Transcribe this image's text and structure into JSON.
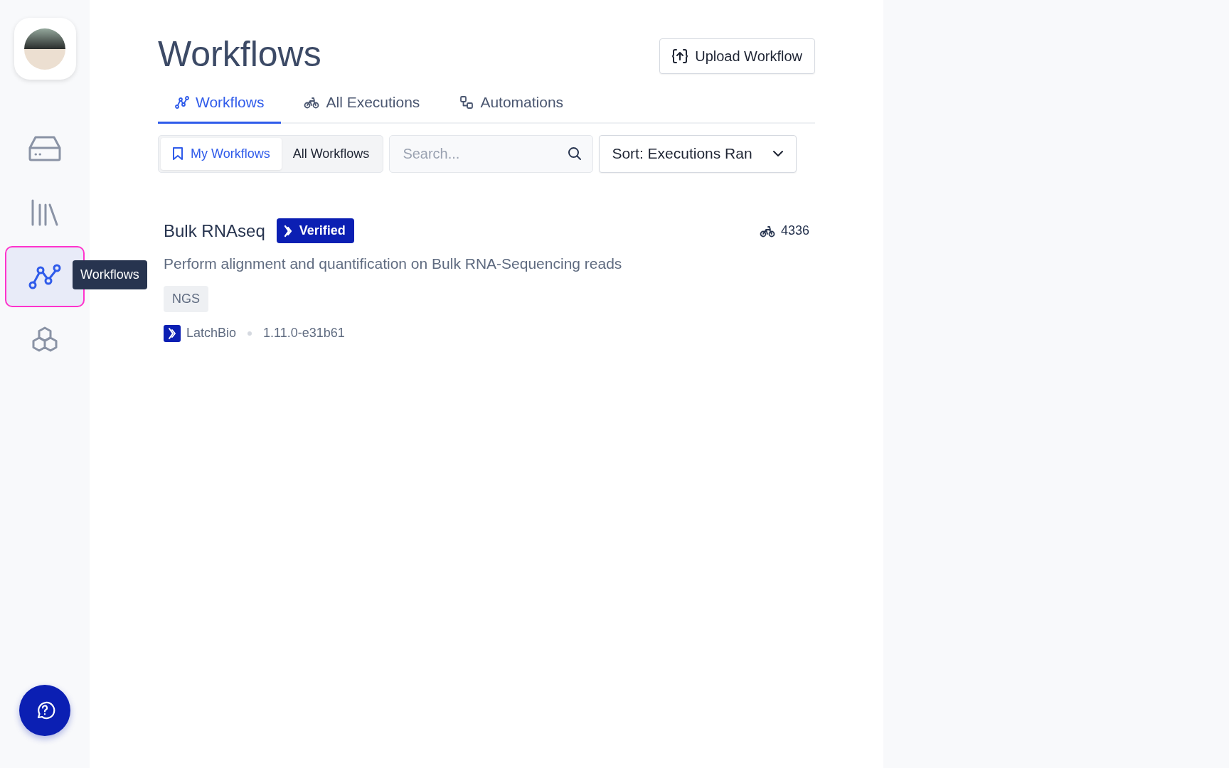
{
  "sidebar": {
    "items": [
      {
        "kind": "drive",
        "selected": false
      },
      {
        "kind": "library",
        "selected": false
      },
      {
        "kind": "workflows",
        "selected": true
      },
      {
        "kind": "hexagons",
        "selected": false
      }
    ],
    "tooltip": "Workflows"
  },
  "header": {
    "title": "Workflows",
    "upload_button": "Upload Workflow"
  },
  "tabs": [
    {
      "label": "Workflows",
      "kind": "workflows",
      "selected": true
    },
    {
      "label": "All Executions",
      "kind": "executions",
      "selected": false
    },
    {
      "label": "Automations",
      "kind": "automations",
      "selected": false
    }
  ],
  "filters": {
    "segments": [
      {
        "label": "My Workflows",
        "selected": true
      },
      {
        "label": "All Workflows",
        "selected": false
      }
    ],
    "search": {
      "placeholder": "Search..."
    },
    "sort": "Sort: Executions Ran"
  },
  "workflows": [
    {
      "name": "Bulk RNAseq",
      "badge": "Verified",
      "executions": "4336",
      "description": "Perform alignment and quantification on Bulk RNA-Sequencing reads",
      "tags": [
        "NGS"
      ],
      "author": "LatchBio",
      "version": "1.11.0-e31b61"
    }
  ]
}
